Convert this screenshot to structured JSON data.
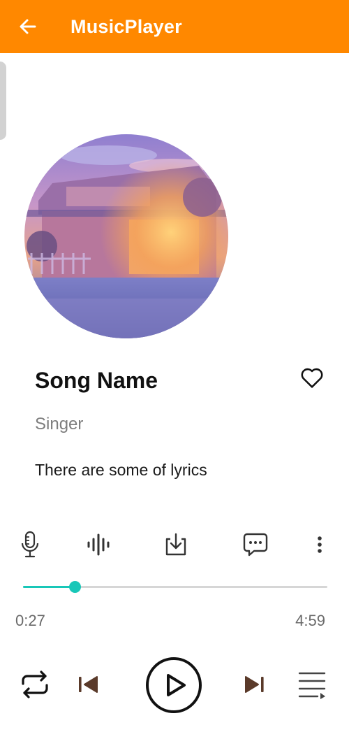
{
  "app": {
    "title": "MusicPlayer",
    "bar_color": "#ff8800"
  },
  "icons": {
    "back": "arrow-left-icon",
    "favorite": "heart-outline-icon",
    "mic": "microphone-icon",
    "sound": "sound-wave-icon",
    "download": "download-icon",
    "comment": "comment-icon",
    "more": "more-vertical-icon",
    "repeat": "repeat-icon",
    "previous": "skip-previous-icon",
    "play": "play-icon",
    "next": "skip-next-icon",
    "playlist": "playlist-icon"
  },
  "song": {
    "name": "Song Name",
    "singer": "Singer",
    "lyrics": "There are some of lyrics"
  },
  "player": {
    "current_time": "0:27",
    "total_time": "4:59",
    "progress": 0.17,
    "accent_color": "#19c7b8"
  }
}
